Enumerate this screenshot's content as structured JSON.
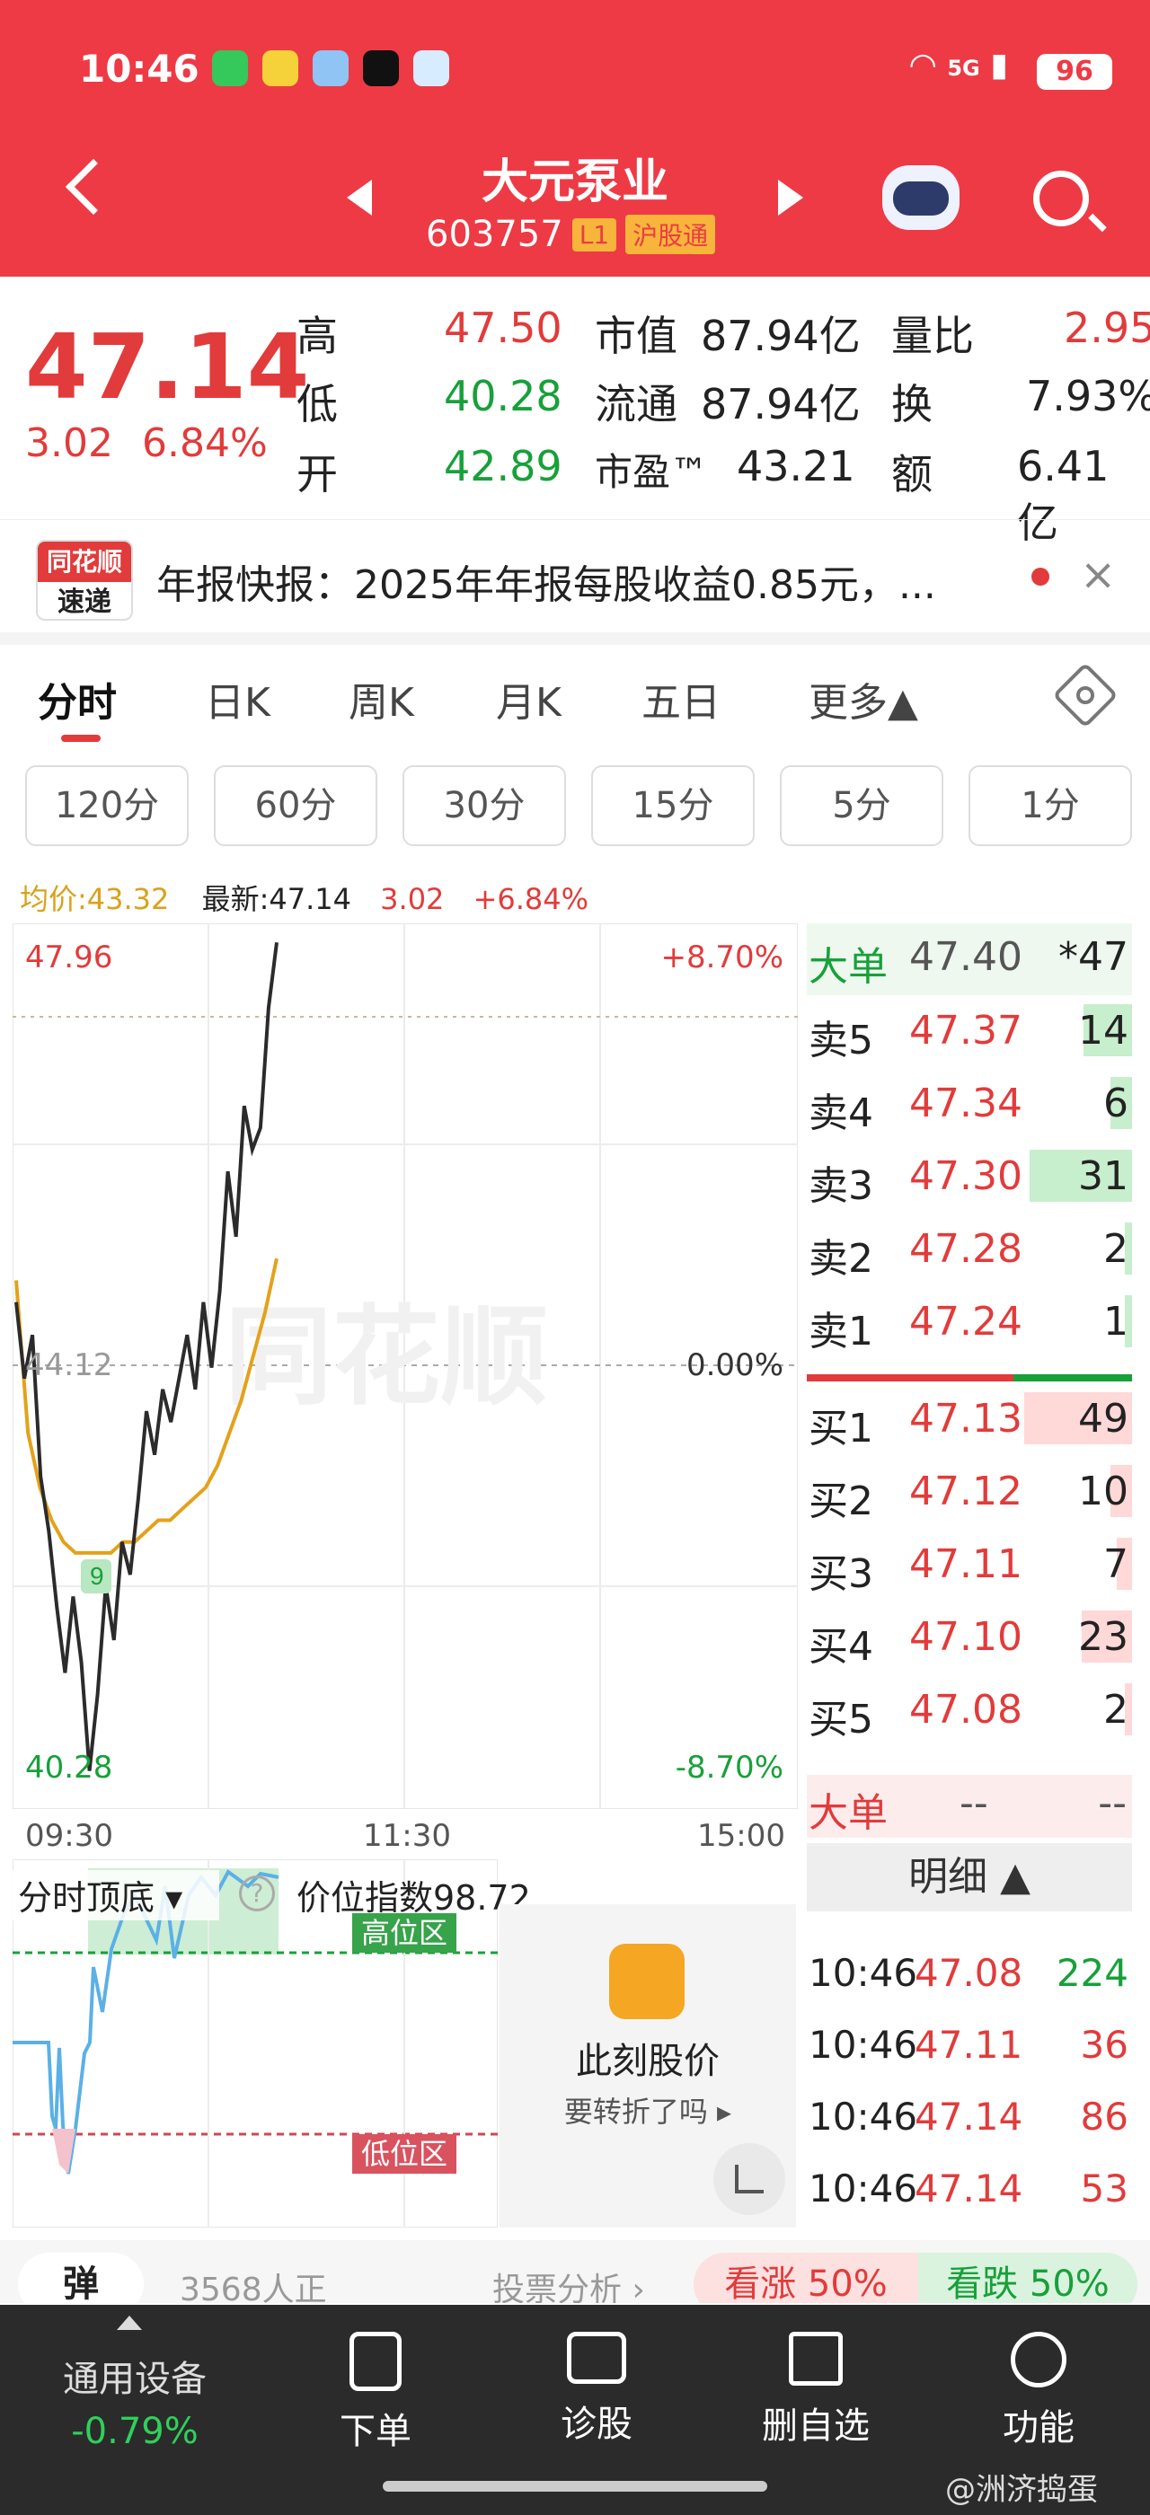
{
  "status_bar": {
    "time": "10:46",
    "network": "5G",
    "battery": "96"
  },
  "header": {
    "stock_name": "大元泵业",
    "stock_code": "603757",
    "level_tag": "L1",
    "connect_tag": "沪股通"
  },
  "quote": {
    "last_price": "47.14",
    "change": "3.02",
    "change_pct": "6.84%",
    "high_label": "高",
    "high": "47.50",
    "low_label": "低",
    "low": "40.28",
    "open_label": "开",
    "open": "42.89",
    "mktcap_label": "市值",
    "mktcap": "87.94亿",
    "float_label": "流通",
    "float": "87.94亿",
    "pe_label": "市盈™",
    "pe": "43.21",
    "vol_ratio_label": "量比",
    "vol_ratio": "2.95",
    "turnover_label": "换",
    "turnover": "7.93%",
    "amount_label": "额",
    "amount": "6.41亿"
  },
  "news": {
    "logo_line1": "同花顺",
    "logo_line2": "速递",
    "text": "年报快报：2025年年报每股收益0.85元，..."
  },
  "tabs": [
    "分时",
    "日K",
    "周K",
    "月K",
    "五日",
    "更多▲"
  ],
  "periods": [
    "120分",
    "60分",
    "30分",
    "15分",
    "5分",
    "1分"
  ],
  "chart_legend": {
    "avg_label": "均价:43.32",
    "latest_label": "最新:47.14",
    "chg": "3.02",
    "chg_pct": "+6.84%"
  },
  "chart_data": {
    "type": "line",
    "y_top": "47.96",
    "y_mid": "44.12",
    "y_bottom": "40.28",
    "pct_top": "+8.70%",
    "pct_mid": "0.00%",
    "pct_bottom": "-8.70%",
    "x_ticks": [
      "09:30",
      "11:30",
      "15:00"
    ],
    "ylim": [
      40.28,
      47.96
    ],
    "watermark": "同花顺",
    "marker_label": "9",
    "series": [
      {
        "name": "price",
        "values": [
          44.6,
          43.9,
          44.3,
          43.0,
          42.5,
          41.8,
          41.2,
          41.9,
          41.3,
          40.3,
          41.0,
          42.0,
          41.5,
          42.4,
          42.1,
          42.8,
          43.6,
          43.2,
          43.8,
          43.5,
          43.9,
          44.3,
          43.8,
          44.6,
          44.0,
          44.7,
          45.8,
          45.2,
          46.4,
          46.0,
          46.2,
          47.3,
          47.9
        ]
      },
      {
        "name": "avg",
        "values": [
          44.8,
          43.4,
          42.9,
          42.6,
          42.4,
          42.3,
          42.3,
          42.3,
          42.3,
          42.4,
          42.4,
          42.5,
          42.6,
          42.6,
          42.7,
          42.8,
          42.9,
          43.1,
          43.4,
          43.7,
          44.1,
          44.5,
          45.0
        ]
      }
    ]
  },
  "order_book": {
    "big_label": "大单",
    "big_price": "47.40",
    "big_vol": "*47",
    "asks": [
      {
        "label": "卖5",
        "price": "47.37",
        "vol": "14",
        "fill": 0.45
      },
      {
        "label": "卖4",
        "price": "47.34",
        "vol": "6",
        "fill": 0.2
      },
      {
        "label": "卖3",
        "price": "47.30",
        "vol": "31",
        "fill": 0.95
      },
      {
        "label": "卖2",
        "price": "47.28",
        "vol": "2",
        "fill": 0.07
      },
      {
        "label": "卖1",
        "price": "47.24",
        "vol": "1",
        "fill": 0.03
      }
    ],
    "bids": [
      {
        "label": "买1",
        "price": "47.13",
        "vol": "49",
        "fill": 1.0
      },
      {
        "label": "买2",
        "price": "47.12",
        "vol": "10",
        "fill": 0.2
      },
      {
        "label": "买3",
        "price": "47.11",
        "vol": "7",
        "fill": 0.14
      },
      {
        "label": "买4",
        "price": "47.10",
        "vol": "23",
        "fill": 0.47
      },
      {
        "label": "买5",
        "price": "47.08",
        "vol": "2",
        "fill": 0.05
      }
    ]
  },
  "big_order_row": {
    "label": "大单",
    "v1": "--",
    "v2": "--"
  },
  "detail": {
    "head": "明细 ▲",
    "rows": [
      {
        "time": "10:46",
        "price": "47.08",
        "vol": "224",
        "color": "#18a03a"
      },
      {
        "time": "10:46",
        "price": "47.11",
        "vol": "36",
        "color": "#e23b3b"
      },
      {
        "time": "10:46",
        "price": "47.14",
        "vol": "86",
        "color": "#e23b3b"
      },
      {
        "time": "10:46",
        "price": "47.14",
        "vol": "53",
        "color": "#e23b3b"
      }
    ]
  },
  "indicator": {
    "title": "分时顶底 ▾",
    "index_label": "价位指数98.72",
    "high_zone": "高位区",
    "low_zone": "低位区"
  },
  "promo": {
    "title": "此刻股价",
    "subtitle": "要转折了吗 ▸"
  },
  "bottom_strip": {
    "left": "弹",
    "count": "3568人正",
    "vote": "投票分析 ›",
    "up": "看涨 50%",
    "down": "看跌 50%"
  },
  "bottom_bar": {
    "index_name": "通用设备",
    "index_chg": "-0.79%",
    "items": [
      "下单",
      "诊股",
      "删自选",
      "功能"
    ]
  },
  "watermark": "@洲济捣蛋"
}
